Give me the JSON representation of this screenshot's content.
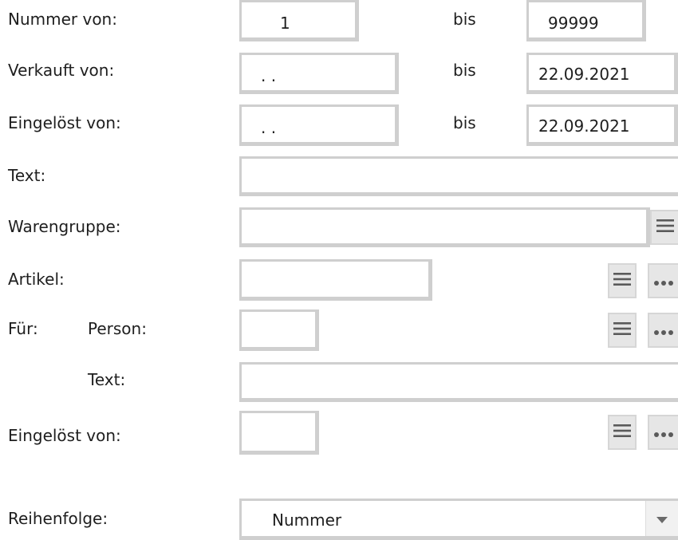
{
  "labels": {
    "nummer_von": "Nummer von:",
    "verkauft_von": "Verkauft von:",
    "eingeloest_von": "Eingelöst von:",
    "text": "Text:",
    "warengruppe": "Warengruppe:",
    "artikel": "Artikel:",
    "fuer": "Für:",
    "person": "Person:",
    "fuer_text": "Text:",
    "eingeloest_von_2": "Eingelöst von:",
    "reihenfolge": "Reihenfolge:",
    "bis": "bis"
  },
  "fields": {
    "nummer_von": "1",
    "nummer_bis": "99999",
    "verkauft_von": ". .",
    "verkauft_bis": "22.09.2021",
    "eingeloest_von": ". .",
    "eingeloest_bis": "22.09.2021",
    "text": "",
    "warengruppe": "",
    "artikel": "",
    "person": "",
    "person_text": "",
    "eingeloest_von_person": ""
  },
  "reihenfolge": {
    "selected": "Nummer"
  },
  "icons": {
    "list": "list-icon",
    "more": "more-dots-icon",
    "dropdown": "chevron-down-icon"
  }
}
